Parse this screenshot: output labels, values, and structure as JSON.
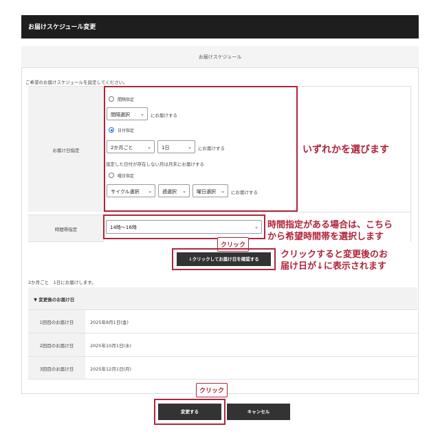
{
  "header": {
    "title": "お届けスケジュール変更"
  },
  "schedule": {
    "heading": "お届けスケジュール",
    "intro": "ご希望のお届けスケジュールを設定してください。",
    "delivery_label": "お届け日指定",
    "interval": {
      "radio_label": "間隔指定",
      "select_value": "間隔選択",
      "suffix": "にお届けする"
    },
    "date": {
      "radio_label": "日付指定",
      "month_value": "2か月ごと",
      "day_value": "1日",
      "suffix": "にお届けする",
      "note": "設定した日付が存在しない月は月末にお届けする"
    },
    "weekday": {
      "radio_label": "曜日指定",
      "cycle_value": "サイクル選択",
      "week_value": "週選択",
      "day_value": "曜日選択",
      "suffix": "にお届けする"
    },
    "time_label": "時間帯指定",
    "time_value": "14時〜16時",
    "confirm_button": "↓クリックしてお届け日を確認する"
  },
  "result": {
    "summary": "2か月ごと　1日にお届けします。",
    "heading": "▼ 変更後のお届け日",
    "rows": [
      {
        "label": "1回目のお届け日",
        "value": "2025年8月1日(金)"
      },
      {
        "label": "2回目のお届け日",
        "value": "2025年10月1日(水)"
      },
      {
        "label": "3回目のお届け日",
        "value": "2025年12月1日(月)"
      }
    ]
  },
  "buttons": {
    "submit": "変更する",
    "cancel": "キャンセル"
  },
  "annotations": {
    "choose_one": "いずれかを選びます",
    "time_line1": "時間指定がある場合は、こちら",
    "time_line2": "から希望時間帯を選択します",
    "click_tag": "クリック",
    "confirm_line1": "クリックすると変更後のお",
    "confirm_line2": "届け日が↓に表示されます"
  },
  "colors": {
    "accent": "#b0243a",
    "header_bg": "#1e1e1e",
    "button_bg": "#333333",
    "radio_on": "#1a73e8"
  }
}
